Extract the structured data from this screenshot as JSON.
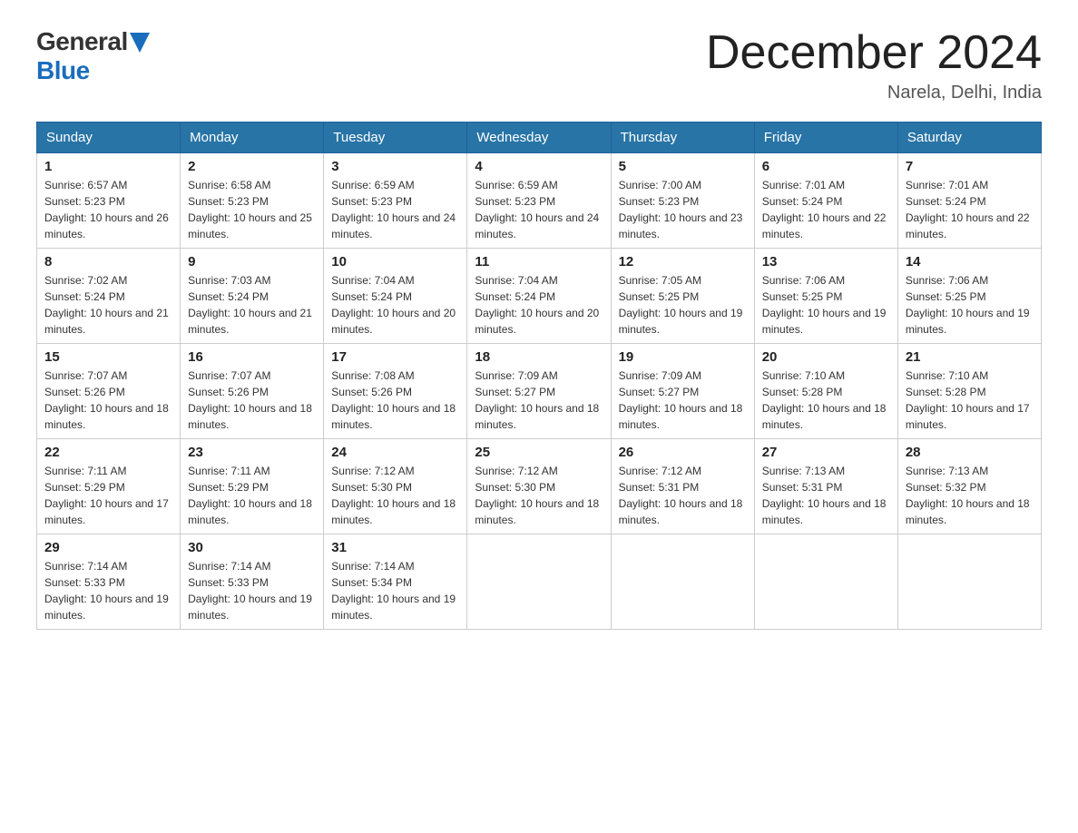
{
  "logo": {
    "general": "General",
    "blue": "Blue"
  },
  "title": "December 2024",
  "location": "Narela, Delhi, India",
  "days_of_week": [
    "Sunday",
    "Monday",
    "Tuesday",
    "Wednesday",
    "Thursday",
    "Friday",
    "Saturday"
  ],
  "weeks": [
    [
      {
        "day": "1",
        "sunrise": "6:57 AM",
        "sunset": "5:23 PM",
        "daylight": "10 hours and 26 minutes."
      },
      {
        "day": "2",
        "sunrise": "6:58 AM",
        "sunset": "5:23 PM",
        "daylight": "10 hours and 25 minutes."
      },
      {
        "day": "3",
        "sunrise": "6:59 AM",
        "sunset": "5:23 PM",
        "daylight": "10 hours and 24 minutes."
      },
      {
        "day": "4",
        "sunrise": "6:59 AM",
        "sunset": "5:23 PM",
        "daylight": "10 hours and 24 minutes."
      },
      {
        "day": "5",
        "sunrise": "7:00 AM",
        "sunset": "5:23 PM",
        "daylight": "10 hours and 23 minutes."
      },
      {
        "day": "6",
        "sunrise": "7:01 AM",
        "sunset": "5:24 PM",
        "daylight": "10 hours and 22 minutes."
      },
      {
        "day": "7",
        "sunrise": "7:01 AM",
        "sunset": "5:24 PM",
        "daylight": "10 hours and 22 minutes."
      }
    ],
    [
      {
        "day": "8",
        "sunrise": "7:02 AM",
        "sunset": "5:24 PM",
        "daylight": "10 hours and 21 minutes."
      },
      {
        "day": "9",
        "sunrise": "7:03 AM",
        "sunset": "5:24 PM",
        "daylight": "10 hours and 21 minutes."
      },
      {
        "day": "10",
        "sunrise": "7:04 AM",
        "sunset": "5:24 PM",
        "daylight": "10 hours and 20 minutes."
      },
      {
        "day": "11",
        "sunrise": "7:04 AM",
        "sunset": "5:24 PM",
        "daylight": "10 hours and 20 minutes."
      },
      {
        "day": "12",
        "sunrise": "7:05 AM",
        "sunset": "5:25 PM",
        "daylight": "10 hours and 19 minutes."
      },
      {
        "day": "13",
        "sunrise": "7:06 AM",
        "sunset": "5:25 PM",
        "daylight": "10 hours and 19 minutes."
      },
      {
        "day": "14",
        "sunrise": "7:06 AM",
        "sunset": "5:25 PM",
        "daylight": "10 hours and 19 minutes."
      }
    ],
    [
      {
        "day": "15",
        "sunrise": "7:07 AM",
        "sunset": "5:26 PM",
        "daylight": "10 hours and 18 minutes."
      },
      {
        "day": "16",
        "sunrise": "7:07 AM",
        "sunset": "5:26 PM",
        "daylight": "10 hours and 18 minutes."
      },
      {
        "day": "17",
        "sunrise": "7:08 AM",
        "sunset": "5:26 PM",
        "daylight": "10 hours and 18 minutes."
      },
      {
        "day": "18",
        "sunrise": "7:09 AM",
        "sunset": "5:27 PM",
        "daylight": "10 hours and 18 minutes."
      },
      {
        "day": "19",
        "sunrise": "7:09 AM",
        "sunset": "5:27 PM",
        "daylight": "10 hours and 18 minutes."
      },
      {
        "day": "20",
        "sunrise": "7:10 AM",
        "sunset": "5:28 PM",
        "daylight": "10 hours and 18 minutes."
      },
      {
        "day": "21",
        "sunrise": "7:10 AM",
        "sunset": "5:28 PM",
        "daylight": "10 hours and 17 minutes."
      }
    ],
    [
      {
        "day": "22",
        "sunrise": "7:11 AM",
        "sunset": "5:29 PM",
        "daylight": "10 hours and 17 minutes."
      },
      {
        "day": "23",
        "sunrise": "7:11 AM",
        "sunset": "5:29 PM",
        "daylight": "10 hours and 18 minutes."
      },
      {
        "day": "24",
        "sunrise": "7:12 AM",
        "sunset": "5:30 PM",
        "daylight": "10 hours and 18 minutes."
      },
      {
        "day": "25",
        "sunrise": "7:12 AM",
        "sunset": "5:30 PM",
        "daylight": "10 hours and 18 minutes."
      },
      {
        "day": "26",
        "sunrise": "7:12 AM",
        "sunset": "5:31 PM",
        "daylight": "10 hours and 18 minutes."
      },
      {
        "day": "27",
        "sunrise": "7:13 AM",
        "sunset": "5:31 PM",
        "daylight": "10 hours and 18 minutes."
      },
      {
        "day": "28",
        "sunrise": "7:13 AM",
        "sunset": "5:32 PM",
        "daylight": "10 hours and 18 minutes."
      }
    ],
    [
      {
        "day": "29",
        "sunrise": "7:14 AM",
        "sunset": "5:33 PM",
        "daylight": "10 hours and 19 minutes."
      },
      {
        "day": "30",
        "sunrise": "7:14 AM",
        "sunset": "5:33 PM",
        "daylight": "10 hours and 19 minutes."
      },
      {
        "day": "31",
        "sunrise": "7:14 AM",
        "sunset": "5:34 PM",
        "daylight": "10 hours and 19 minutes."
      },
      null,
      null,
      null,
      null
    ]
  ]
}
